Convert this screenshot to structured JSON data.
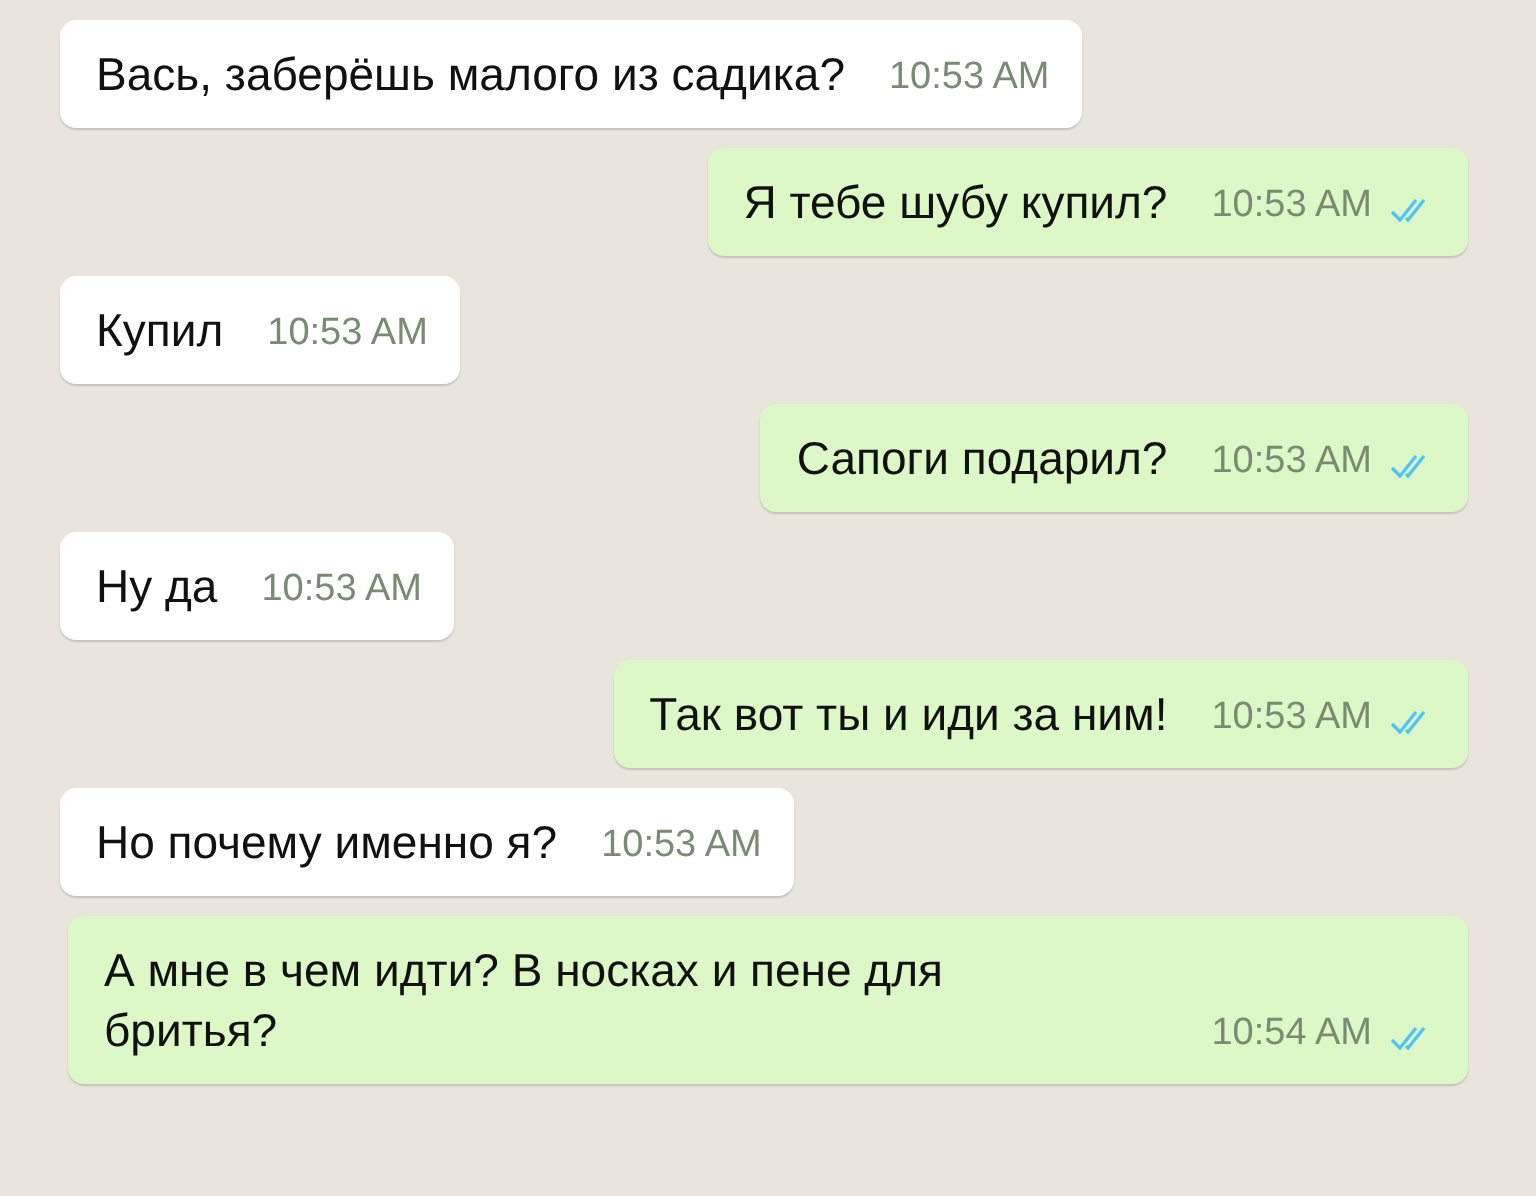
{
  "messages": [
    {
      "kind": "incoming",
      "text": "Вась, заберёшь малого из садика?",
      "time": "10:53 AM"
    },
    {
      "kind": "outgoing",
      "text": "Я тебе шубу купил?",
      "time": "10:53 AM",
      "read": true
    },
    {
      "kind": "incoming",
      "text": "Купил",
      "time": "10:53 AM"
    },
    {
      "kind": "outgoing",
      "text": "Сапоги подарил?",
      "time": "10:53 AM",
      "read": true
    },
    {
      "kind": "incoming",
      "text": "Ну да",
      "time": "10:53 AM"
    },
    {
      "kind": "outgoing",
      "text": "Так вот ты и иди за ним!",
      "time": "10:53 AM",
      "read": true
    },
    {
      "kind": "incoming",
      "text": "Но почему именно я?",
      "time": "10:53 AM"
    },
    {
      "kind": "outgoing",
      "text": "А мне в чем идти? В носках и пене для бритья?",
      "time": "10:54 AM",
      "read": true
    }
  ]
}
